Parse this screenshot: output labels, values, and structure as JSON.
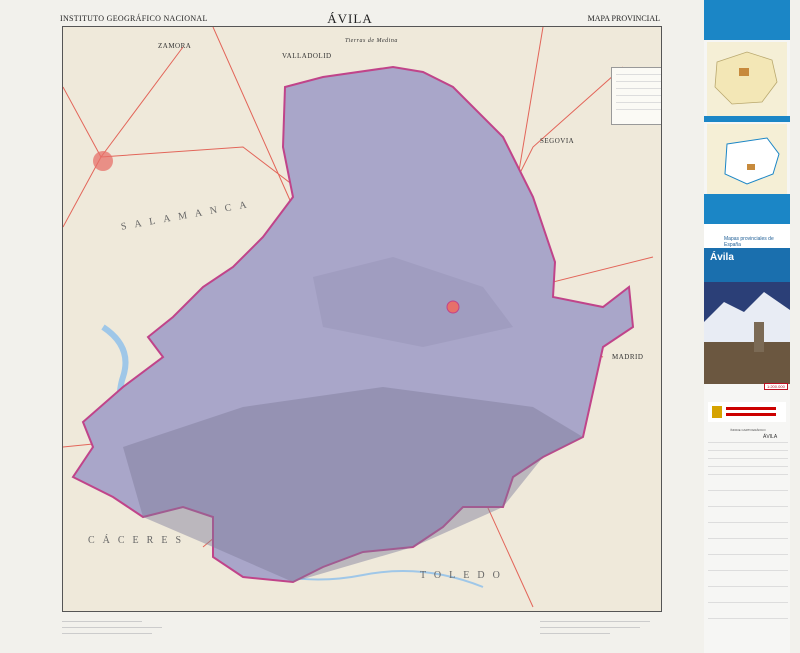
{
  "header": {
    "publisher": "INSTITUTO GEOGRÁFICO NACIONAL",
    "title": "ÁVILA",
    "series_type": "MAPA PROVINCIAL"
  },
  "map": {
    "labels": {
      "zamora": "ZAMORA",
      "valladolid": "VALLADOLID",
      "tierras_medina": "Tierras de Medina",
      "segovia": "SEGOVIA",
      "madrid": "MADRID",
      "caceres": "CÁCERES",
      "salamanca": "SALAMANCA",
      "toledo": "TOLEDO"
    },
    "colors": {
      "province": "#a9a6c9",
      "surrounding": "#efe9da",
      "border": "#c0448a",
      "roads": "#e0453a",
      "water": "#9fc7e8"
    }
  },
  "panel": {
    "series_title": "Mapas provinciales de España",
    "province": "Ávila",
    "scale_badge": "1:200.000",
    "index_title": "ÍNDICE CARTOGRÁFICO",
    "index_name": "ÁVILA",
    "colors": {
      "brand_blue": "#1b86c6",
      "band_blue": "#1a6fae"
    }
  }
}
